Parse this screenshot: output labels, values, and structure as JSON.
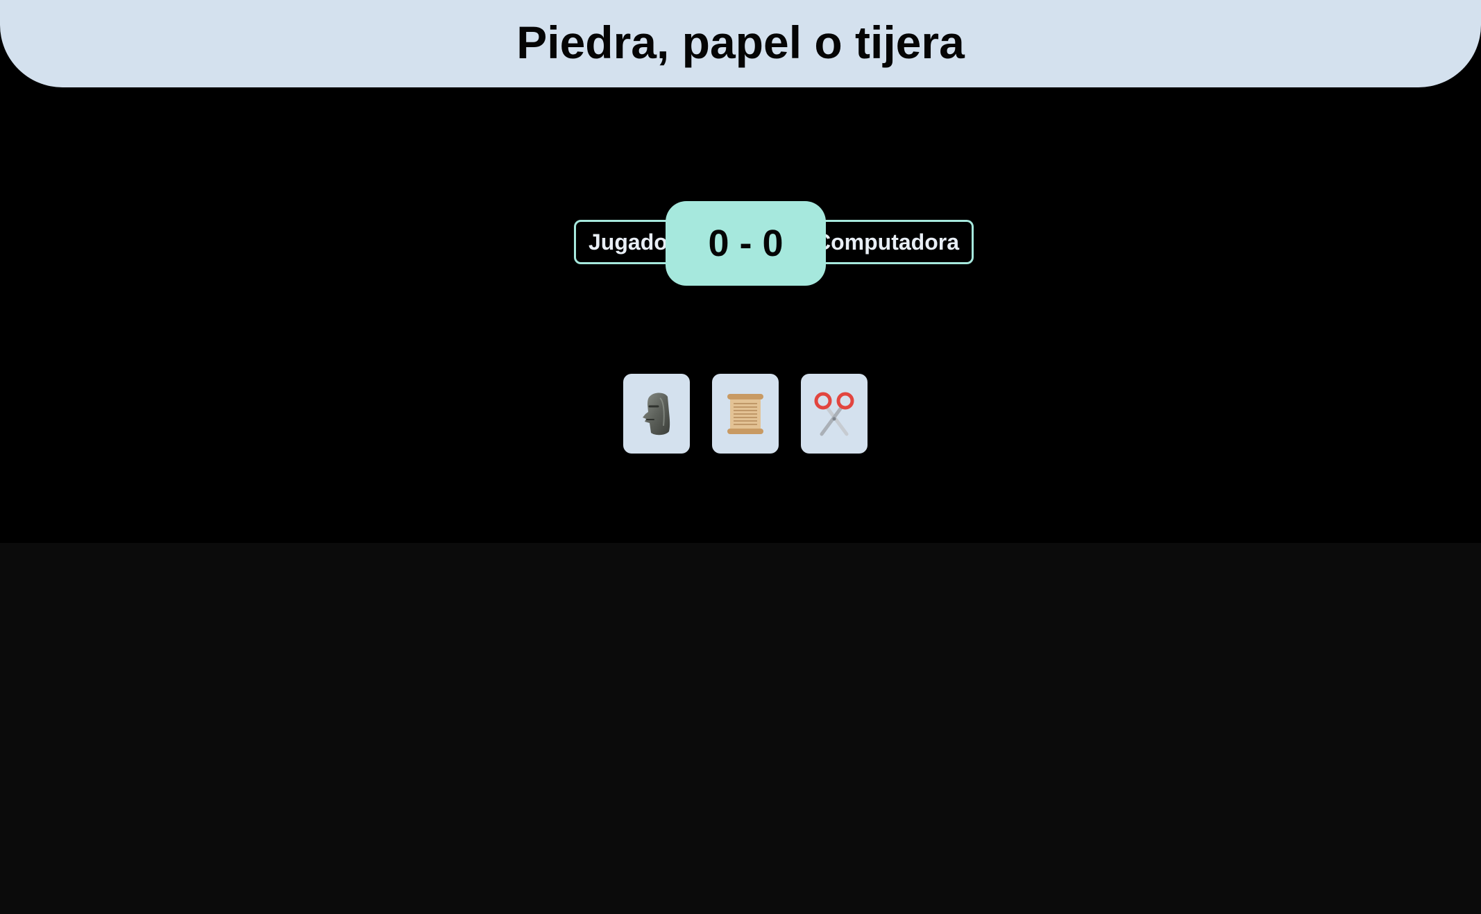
{
  "header": {
    "title": "Piedra, papel o tijera"
  },
  "scoreboard": {
    "player_label": "Jugador",
    "computer_label": "Computadora",
    "player_score": 0,
    "computer_score": 0,
    "score_text": "0 - 0"
  },
  "choices": [
    {
      "name": "Piedra",
      "icon": "moai-stone-head-icon"
    },
    {
      "name": "Papel",
      "icon": "scroll-icon"
    },
    {
      "name": "Tijera",
      "icon": "scissors-icon"
    }
  ],
  "colors": {
    "header_bg": "#d4e1ee",
    "accent": "#a6e8dd",
    "game_bg": "#000000",
    "page_bg": "#0b0b0b",
    "button_bg": "#d4e1ee"
  }
}
